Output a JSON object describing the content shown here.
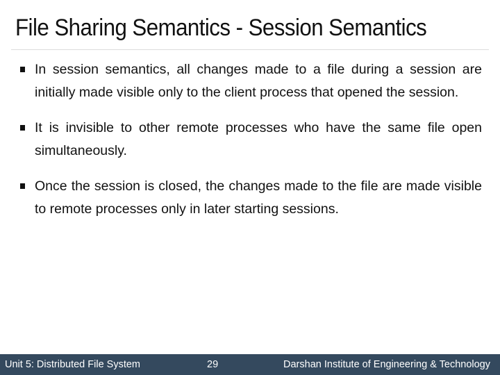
{
  "slide": {
    "title": "File Sharing Semantics - Session Semantics",
    "bullets": [
      "In session semantics, all changes made to a file during a session are initially made visible only to the client process that opened the session.",
      "It is invisible to other remote processes who have the same file open simultaneously.",
      "Once the session is closed, the changes made to the file are made visible to remote processes only in later starting sessions."
    ]
  },
  "footer": {
    "left": "Unit 5: Distributed File System",
    "page_number": "29",
    "right": "Darshan Institute of Engineering & Technology",
    "background_color": "#34495e"
  },
  "icons": {
    "bullet_marker": "square-bullet-icon"
  }
}
